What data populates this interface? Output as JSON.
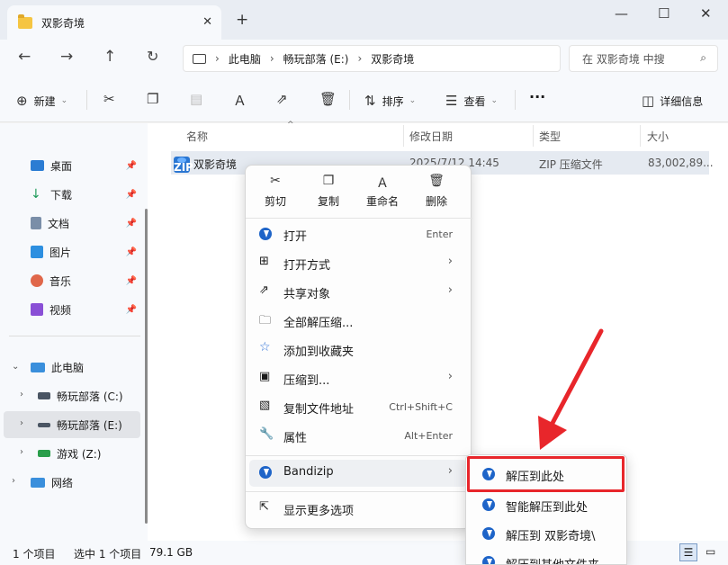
{
  "window": {
    "tab_title": "双影奇境",
    "minimize_icon": "minimize-icon",
    "maximize_icon": "maximize-icon",
    "close_icon": "close-icon"
  },
  "address": {
    "crumbs": [
      "此电脑",
      "畅玩部落 (E:)",
      "双影奇境"
    ],
    "search_placeholder": "在 双影奇境 中搜"
  },
  "toolbar": {
    "new_label": "新建",
    "sort_label": "排序",
    "view_label": "查看",
    "details_label": "详细信息"
  },
  "sidebar": {
    "quick": [
      {
        "label": "桌面",
        "color": "#2b7cd3"
      },
      {
        "label": "下载",
        "color": "#1f9b5a"
      },
      {
        "label": "文档",
        "color": "#7a8ea8"
      },
      {
        "label": "图片",
        "color": "#2d8fe0"
      },
      {
        "label": "音乐",
        "color": "#e0674a"
      },
      {
        "label": "视频",
        "color": "#8a4fd6"
      }
    ],
    "pc_label": "此电脑",
    "drives": [
      {
        "label": "畅玩部落 (C:)"
      },
      {
        "label": "畅玩部落 (E:)"
      },
      {
        "label": "游戏 (Z:)"
      }
    ],
    "network_label": "网络"
  },
  "columns": {
    "name": "名称",
    "date": "修改日期",
    "type": "类型",
    "size": "大小"
  },
  "file": {
    "name": "双影奇境",
    "date": "2025/7/12 14:45",
    "type": "ZIP 压缩文件",
    "size": "83,002,89..."
  },
  "context_menu": {
    "quick_actions": [
      {
        "label": "剪切",
        "icon": "cut-icon"
      },
      {
        "label": "复制",
        "icon": "copy-icon"
      },
      {
        "label": "重命名",
        "icon": "rename-icon"
      },
      {
        "label": "删除",
        "icon": "delete-icon"
      }
    ],
    "items": [
      {
        "label": "打开",
        "shortcut": "Enter",
        "arrow": ""
      },
      {
        "label": "打开方式",
        "shortcut": "",
        "arrow": "›"
      },
      {
        "label": "共享对象",
        "shortcut": "",
        "arrow": "›"
      },
      {
        "label": "全部解压缩...",
        "shortcut": "",
        "arrow": ""
      },
      {
        "label": "添加到收藏夹",
        "shortcut": "",
        "arrow": ""
      },
      {
        "label": "压缩到...",
        "shortcut": "",
        "arrow": "›"
      },
      {
        "label": "复制文件地址",
        "shortcut": "Ctrl+Shift+C",
        "arrow": ""
      },
      {
        "label": "属性",
        "shortcut": "Alt+Enter",
        "arrow": ""
      },
      {
        "label": "Bandizip",
        "shortcut": "",
        "arrow": "›"
      },
      {
        "label": "显示更多选项",
        "shortcut": "",
        "arrow": ""
      }
    ]
  },
  "submenu": {
    "items": [
      "解压到此处",
      "智能解压到此处",
      "解压到 双影奇境\\",
      "解压到其他文件夹..."
    ]
  },
  "status": {
    "count": "1 个项目",
    "selected": "选中 1 个项目",
    "size": "79.1 GB"
  },
  "colors": {
    "highlight": "#e8262b",
    "bandizip": "#1e64c8",
    "selection": "#e5eaf1"
  }
}
